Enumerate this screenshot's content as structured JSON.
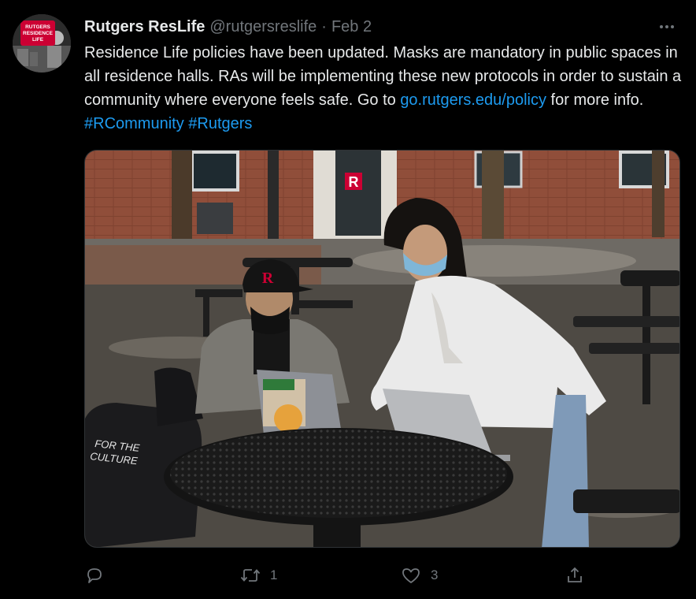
{
  "tweet": {
    "author": {
      "display_name": "Rutgers ResLife",
      "handle": "@rutgersreslife",
      "avatar_text": [
        "RUTGERS",
        "RESIDENCE",
        "LIFE"
      ]
    },
    "separator": "·",
    "date": "Feb 2",
    "text": {
      "body": "Residence Life policies have been updated. Masks are mandatory in public spaces in all residence halls. RAs will be implementing these new protocols in order to sustain a community where everyone feels safe. Go to ",
      "link": "go.rutgers.edu/policy",
      "after_link": " for more info. ",
      "hashtag1": "#RCommunity",
      "space": " ",
      "hashtag2": "#Rutgers"
    },
    "media": {
      "bag_text": [
        "FOR THE",
        "CULTURE"
      ],
      "cap_letter": "R"
    },
    "actions": {
      "reply_count": "",
      "retweet_count": "1",
      "like_count": "3"
    }
  },
  "colors": {
    "background": "#000000",
    "text": "#e7e9ea",
    "secondary": "#71767b",
    "link": "#1d9bf0",
    "brand_red": "#cc0033"
  }
}
